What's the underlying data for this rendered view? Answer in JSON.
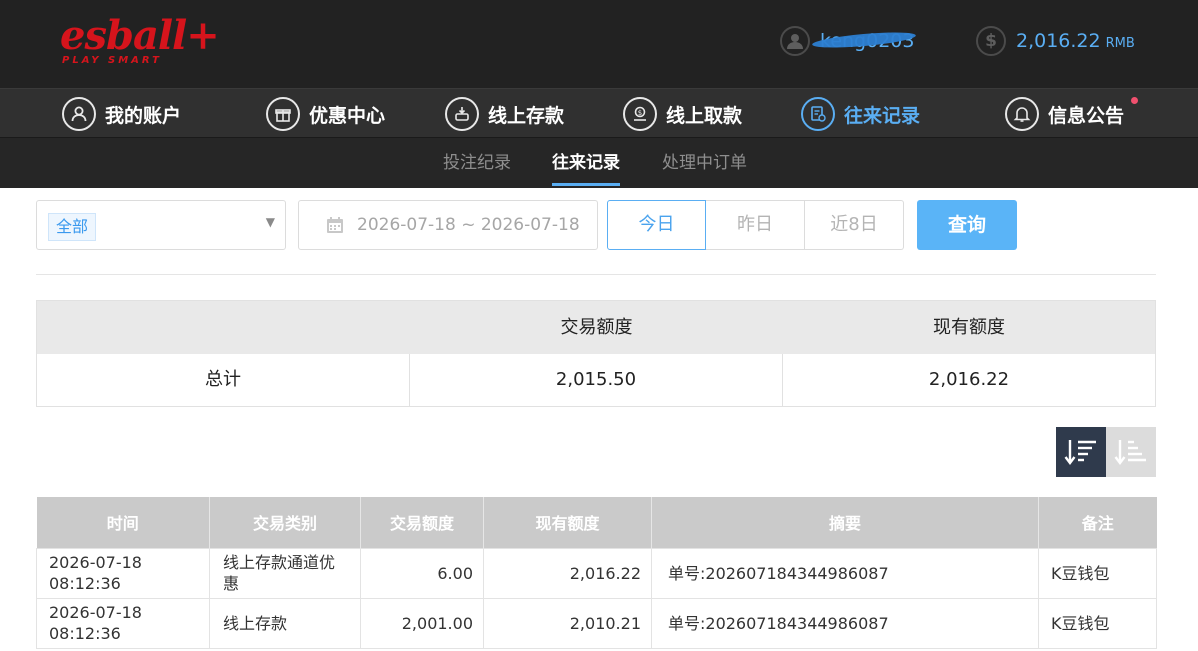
{
  "header": {
    "logo_text": "esball+",
    "logo_tagline": "PLAY SMART",
    "username": "keng0203",
    "balance": "2,016.22",
    "currency": "RMB"
  },
  "nav": {
    "items": [
      {
        "label": "我的账户",
        "icon": "user-icon",
        "glyph": "◉"
      },
      {
        "label": "优惠中心",
        "icon": "gift-icon",
        "glyph": "✚"
      },
      {
        "label": "线上存款",
        "icon": "deposit-icon",
        "glyph": "↓"
      },
      {
        "label": "线上取款",
        "icon": "withdraw-icon",
        "glyph": "$"
      },
      {
        "label": "往来记录",
        "icon": "records-icon",
        "glyph": "☰"
      },
      {
        "label": "信息公告",
        "icon": "bell-icon",
        "glyph": "♪"
      }
    ]
  },
  "subnav": {
    "items": [
      {
        "label": "投注纪录"
      },
      {
        "label": "往来记录"
      },
      {
        "label": "处理中订单"
      }
    ]
  },
  "filters": {
    "type_value": "全部",
    "date_range": "2026-07-18 ~ 2026-07-18",
    "day_buttons": [
      "今日",
      "昨日",
      "近8日"
    ],
    "query_label": "查询"
  },
  "summary": {
    "headers": [
      "",
      "交易额度",
      "现有额度"
    ],
    "row_label": "总计",
    "trade_amount": "2,015.50",
    "current_amount": "2,016.22"
  },
  "records": {
    "columns": [
      "时间",
      "交易类别",
      "交易额度",
      "现有额度",
      "摘要",
      "备注"
    ],
    "rows": [
      [
        "2026-07-18 08:12:36",
        "线上存款通道优惠",
        "6.00",
        "2,016.22",
        "单号:202607184344986087",
        "K豆钱包"
      ],
      [
        "2026-07-18 08:12:36",
        "线上存款",
        "2,001.00",
        "2,010.21",
        "单号:202607184344986087",
        "K豆钱包"
      ]
    ]
  },
  "colors": {
    "accent": "#5aaef3",
    "brand_red": "#d6141c",
    "header_bg": "#222222",
    "nav_bg": "#303030"
  }
}
